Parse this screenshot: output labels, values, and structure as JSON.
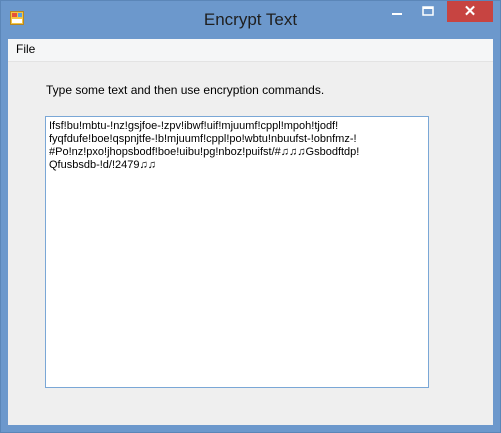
{
  "window": {
    "title": "Encrypt Text",
    "controls": {
      "minimize": "–",
      "maximize": "☐",
      "close": "✕"
    },
    "colors": {
      "frame": "#6c98cc",
      "close": "#c74441",
      "client": "#efefef"
    }
  },
  "menu": {
    "items": [
      {
        "label": "File"
      }
    ]
  },
  "main": {
    "instruction": "Type some text and then use encryption commands.",
    "text_content": "Ifsf!bu!mbtu-!nz!gsjfoe-!zpv!ibwf!uif!mjuumf!cppl!mpoh!tjodf!\nfyqfdufe!boe!qspnjtfe-!b!mjuumf!cppl!po!wbtu!nbuufst-!obnfmz-!\n#Po!nz!pxo!jhopsbodf!boe!uibu!pg!nboz!puifst/#♫♫♫Gsbodftdp!\nQfusbsdb-!d/!2479♫♫"
  },
  "icons": {
    "app": "app-window-icon"
  }
}
